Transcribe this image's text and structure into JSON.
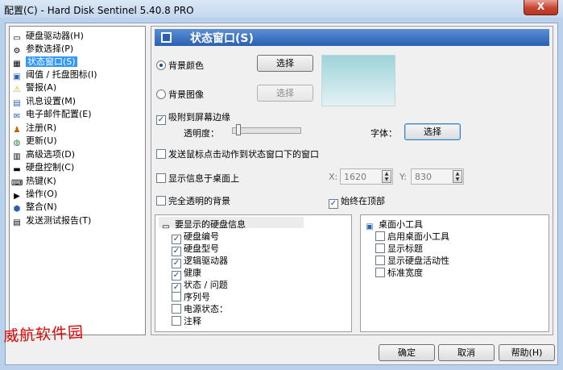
{
  "window": {
    "title": "配置(C)  -  Hard Disk Sentinel 5.40.8 PRO",
    "close_label": "X"
  },
  "sidebar": {
    "items": [
      {
        "label": "硬盘驱动器(H)",
        "icon": "hdd-icon"
      },
      {
        "label": "参数选择(P)",
        "icon": "preferences-icon"
      },
      {
        "label": "状态窗口(S)",
        "icon": "status-window-icon"
      },
      {
        "label": "阈值 / 托盘图标(I)",
        "icon": "tray-icon"
      },
      {
        "label": "警报(A)",
        "icon": "warning-icon"
      },
      {
        "label": "讯息设置(M)",
        "icon": "message-icon"
      },
      {
        "label": "电子邮件配置(E)",
        "icon": "email-icon"
      },
      {
        "label": "注册(R)",
        "icon": "register-icon"
      },
      {
        "label": "更新(U)",
        "icon": "update-globe-icon"
      },
      {
        "label": "高级选项(D)",
        "icon": "advanced-icon"
      },
      {
        "label": "硬盘控制(C)",
        "icon": "disk-control-icon"
      },
      {
        "label": "热键(K)",
        "icon": "hotkey-icon"
      },
      {
        "label": "操作(O)",
        "icon": "actions-icon"
      },
      {
        "label": "整合(N)",
        "icon": "integration-icon"
      },
      {
        "label": "发送测试报告(T)",
        "icon": "report-icon"
      }
    ],
    "selected_index": 2
  },
  "content": {
    "header_title": "状态窗口(S)",
    "bg_color_label": "背景颜色",
    "bg_image_label": "背景图像",
    "select_label": "选择",
    "swatch_color": "#b8e0e6",
    "snap_label": "吸附到屏幕边缘",
    "transparency_label": "透明度：",
    "font_label": "字体：",
    "send_click_label": "发送鼠标点击动作到状态窗口下的窗口",
    "show_desktop_label": "显示信息于桌面上",
    "x_label": "X:",
    "x_value": "1620",
    "y_label": "Y:",
    "y_value": "830",
    "transparent_bg_label": "完全透明的背景",
    "always_on_top_label": "始终在顶部",
    "disk_info": {
      "header": "要显示的硬盘信息",
      "items": [
        {
          "label": "硬盘编号",
          "checked": true
        },
        {
          "label": "硬盘型号",
          "checked": true
        },
        {
          "label": "逻辑驱动器",
          "checked": true
        },
        {
          "label": "健康",
          "checked": true
        },
        {
          "label": "状态 / 问题",
          "checked": true
        },
        {
          "label": "序列号",
          "checked": false
        },
        {
          "label": "电源状态：",
          "checked": false
        },
        {
          "label": "注释",
          "checked": false
        }
      ]
    },
    "gadget": {
      "header": "桌面小工具",
      "items": [
        {
          "label": "启用桌面小工具",
          "checked": false
        },
        {
          "label": "显示标题",
          "checked": false
        },
        {
          "label": "显示硬盘活动性",
          "checked": false
        },
        {
          "label": "标准宽度",
          "checked": false
        }
      ]
    }
  },
  "footer": {
    "ok": "确定",
    "cancel": "取消",
    "help": "帮助(H)"
  },
  "watermark": "威航软件园"
}
